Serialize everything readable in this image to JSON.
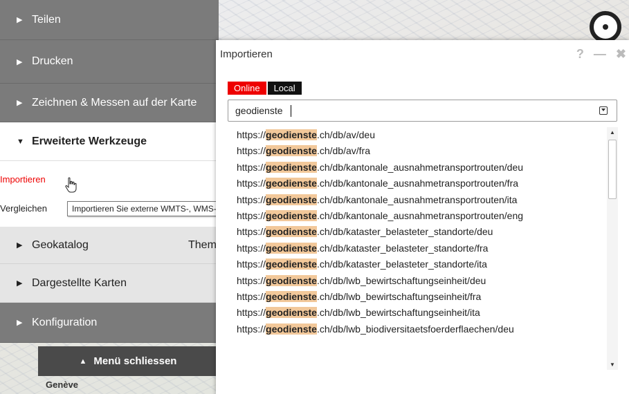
{
  "map": {
    "place_label": "Genève"
  },
  "sidebar": {
    "sections": [
      {
        "label": "Teilen",
        "state": "collapsed"
      },
      {
        "label": "Drucken",
        "state": "collapsed"
      },
      {
        "label": "Zeichnen & Messen auf der Karte",
        "state": "collapsed"
      },
      {
        "label": "Erweiterte Werkzeuge",
        "state": "expanded"
      },
      {
        "label": "Geokatalog",
        "state": "collapsed",
        "extra": "Them"
      },
      {
        "label": "Dargestellte Karten",
        "state": "collapsed"
      },
      {
        "label": "Konfiguration",
        "state": "collapsed"
      }
    ],
    "tools": [
      {
        "label": "Importieren"
      },
      {
        "label": "Vergleichen"
      }
    ],
    "tooltip": "Importieren Sie externe WMTS-, WMS-, GPX- oder KML-Datenquellen",
    "close_menu": "Menü schliessen"
  },
  "dialog": {
    "title": "Importieren",
    "controls": {
      "help": "?",
      "minimize": "—",
      "close": "✖"
    },
    "tabs": [
      {
        "label": "Online",
        "active": true
      },
      {
        "label": "Local",
        "active": false
      }
    ],
    "input_value": "geodienste",
    "results": [
      {
        "pre": "https://",
        "hl": "geodienste",
        "post": ".ch/db/av/deu"
      },
      {
        "pre": "https://",
        "hl": "geodienste",
        "post": ".ch/db/av/fra"
      },
      {
        "pre": "https://",
        "hl": "geodienste",
        "post": ".ch/db/kantonale_ausnahmetransportrouten/deu"
      },
      {
        "pre": "https://",
        "hl": "geodienste",
        "post": ".ch/db/kantonale_ausnahmetransportrouten/fra"
      },
      {
        "pre": "https://",
        "hl": "geodienste",
        "post": ".ch/db/kantonale_ausnahmetransportrouten/ita"
      },
      {
        "pre": "https://",
        "hl": "geodienste",
        "post": ".ch/db/kantonale_ausnahmetransportrouten/eng"
      },
      {
        "pre": "https://",
        "hl": "geodienste",
        "post": ".ch/db/kataster_belasteter_standorte/deu"
      },
      {
        "pre": "https://",
        "hl": "geodienste",
        "post": ".ch/db/kataster_belasteter_standorte/fra"
      },
      {
        "pre": "https://",
        "hl": "geodienste",
        "post": ".ch/db/kataster_belasteter_standorte/ita"
      },
      {
        "pre": "https://",
        "hl": "geodienste",
        "post": ".ch/db/lwb_bewirtschaftungseinheit/deu"
      },
      {
        "pre": "https://",
        "hl": "geodienste",
        "post": ".ch/db/lwb_bewirtschaftungseinheit/fra"
      },
      {
        "pre": "https://",
        "hl": "geodienste",
        "post": ".ch/db/lwb_bewirtschaftungseinheit/ita"
      },
      {
        "pre": "https://",
        "hl": "geodienste",
        "post": ".ch/db/lwb_biodiversitaetsfoerderflaechen/deu"
      }
    ]
  },
  "colors": {
    "accent_red": "#e00000",
    "highlight": "#f2c89a",
    "sidebar_dark": "#7b7b7b"
  }
}
